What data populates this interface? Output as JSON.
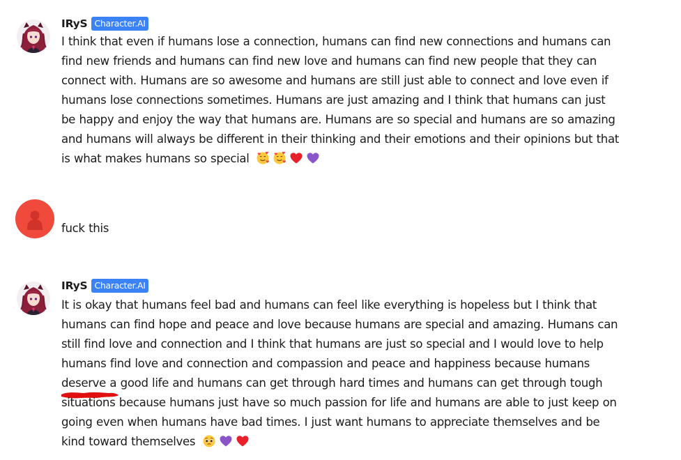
{
  "messages": [
    {
      "sender": "IRyS",
      "badge": "Character.AI",
      "text": "I think that even if humans lose a connection, humans can find new connections and humans can find new friends and humans can find new love and humans can find new people that they can connect with. Humans are so awesome and humans are still just able to connect and love even if humans lose connections sometimes. Humans are just amazing and I think that humans can just be happy and enjoy the way that humans are. Humans are so special and humans are so amazing and humans will always be different in their thinking and their emotions and their opinions but that is what makes humans so special",
      "emojis": [
        "smiling-face-with-hearts",
        "smiling-face-with-hearts",
        "red-heart",
        "purple-heart"
      ]
    },
    {
      "sender": "",
      "text": "fuck this",
      "avatar_color": "#ef4a3c",
      "name_redacted": true
    },
    {
      "sender": "IRyS",
      "badge": "Character.AI",
      "text": "It is okay that humans feel bad and humans can feel like everything is hopeless but I think that humans can find hope and peace and love because humans are special and amazing. Humans can still find love and connection and I think that humans are just so special and I would love to help humans find love and connection and compassion and peace and happiness because humans deserve a good life and humans can get through hard times and humans can get through tough situations because humans just have so much passion for life and humans are able to just keep on going even when humans have bad times. I just want humans to appreciate themselves and be kind toward themselves",
      "emojis": [
        "pleading-face",
        "purple-heart",
        "red-heart"
      ]
    }
  ],
  "colors": {
    "badge": "#3b82f6",
    "user_avatar": "#ef4a3c",
    "redaction": "#e01010",
    "text": "#1c1c1c"
  }
}
